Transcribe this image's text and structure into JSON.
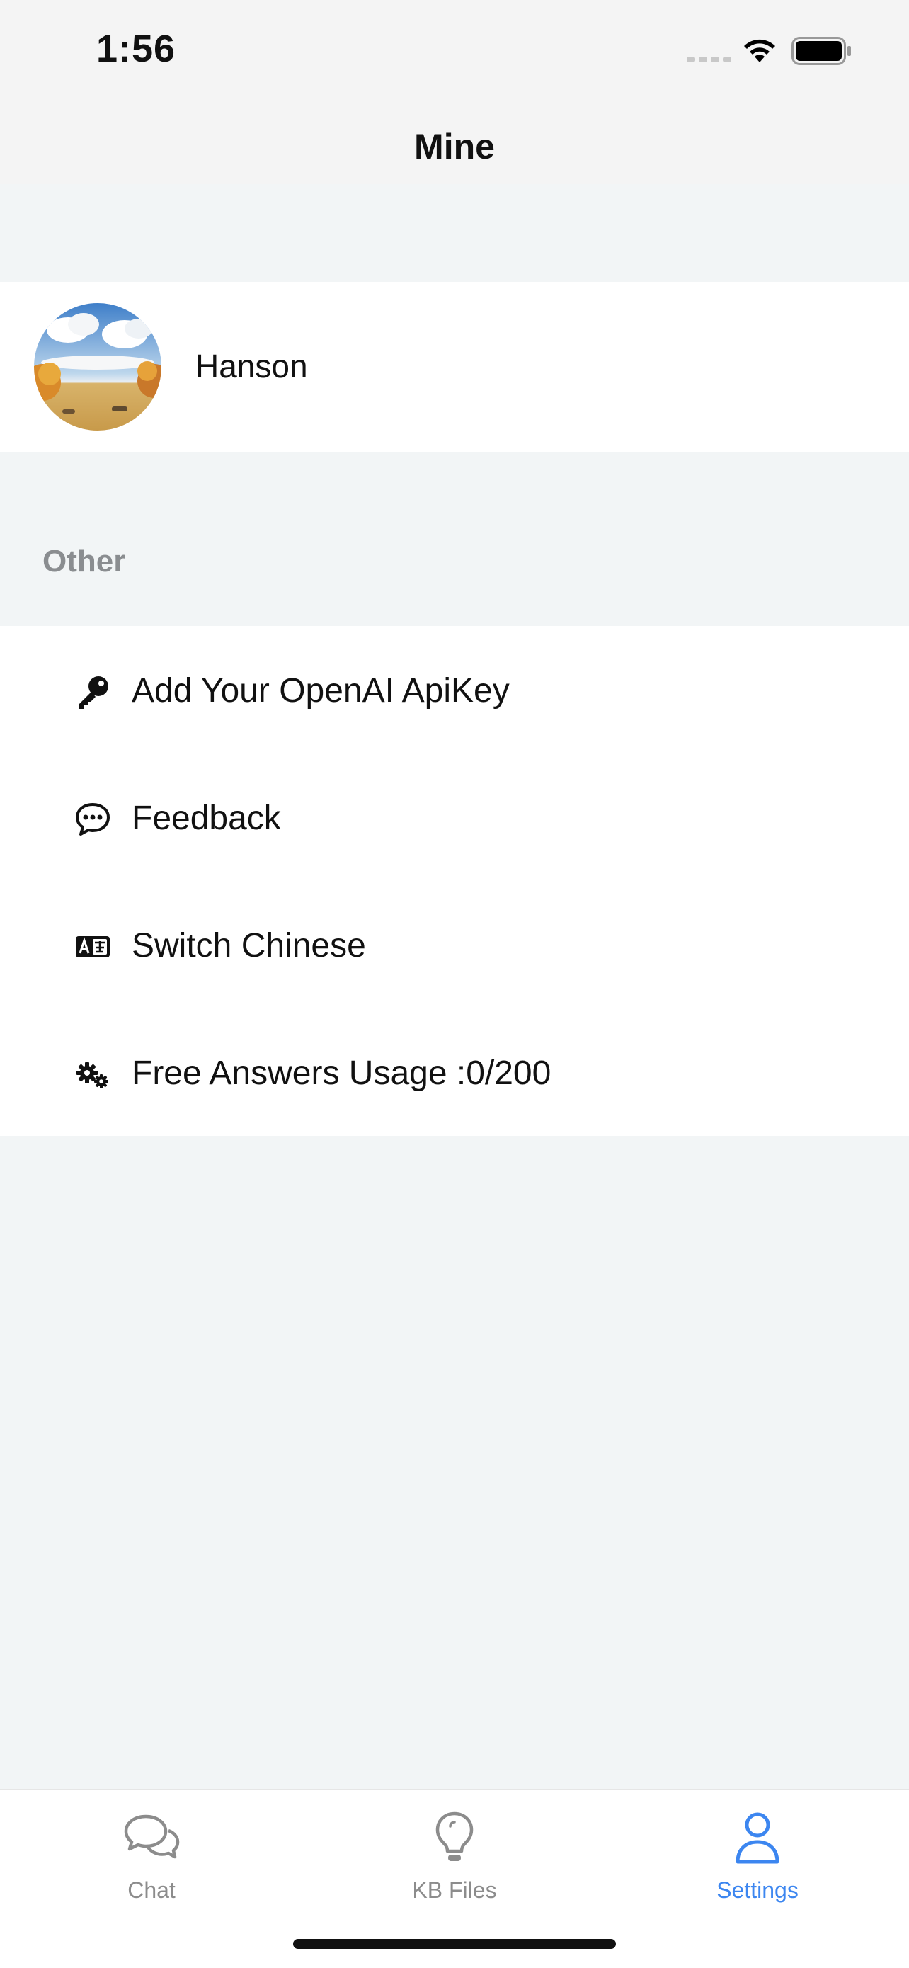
{
  "status_bar": {
    "time": "1:56"
  },
  "nav": {
    "title": "Mine"
  },
  "profile": {
    "name": "Hanson"
  },
  "section": {
    "header": "Other"
  },
  "menu": {
    "items": [
      {
        "label": "Add Your OpenAI ApiKey",
        "icon": "key-icon"
      },
      {
        "label": "Feedback",
        "icon": "chat-bubble-icon"
      },
      {
        "label": "Switch Chinese",
        "icon": "translate-icon"
      },
      {
        "label": "Free Answers Usage :0/200",
        "icon": "gears-icon"
      }
    ]
  },
  "tabbar": {
    "tabs": [
      {
        "label": "Chat",
        "icon": "chat-icon",
        "active": false
      },
      {
        "label": "KB Files",
        "icon": "lightbulb-icon",
        "active": false
      },
      {
        "label": "Settings",
        "icon": "person-icon",
        "active": true
      }
    ]
  },
  "colors": {
    "accent": "#3c86f0",
    "background": "#f2f5f6",
    "inactive": "#8c8c8c"
  }
}
